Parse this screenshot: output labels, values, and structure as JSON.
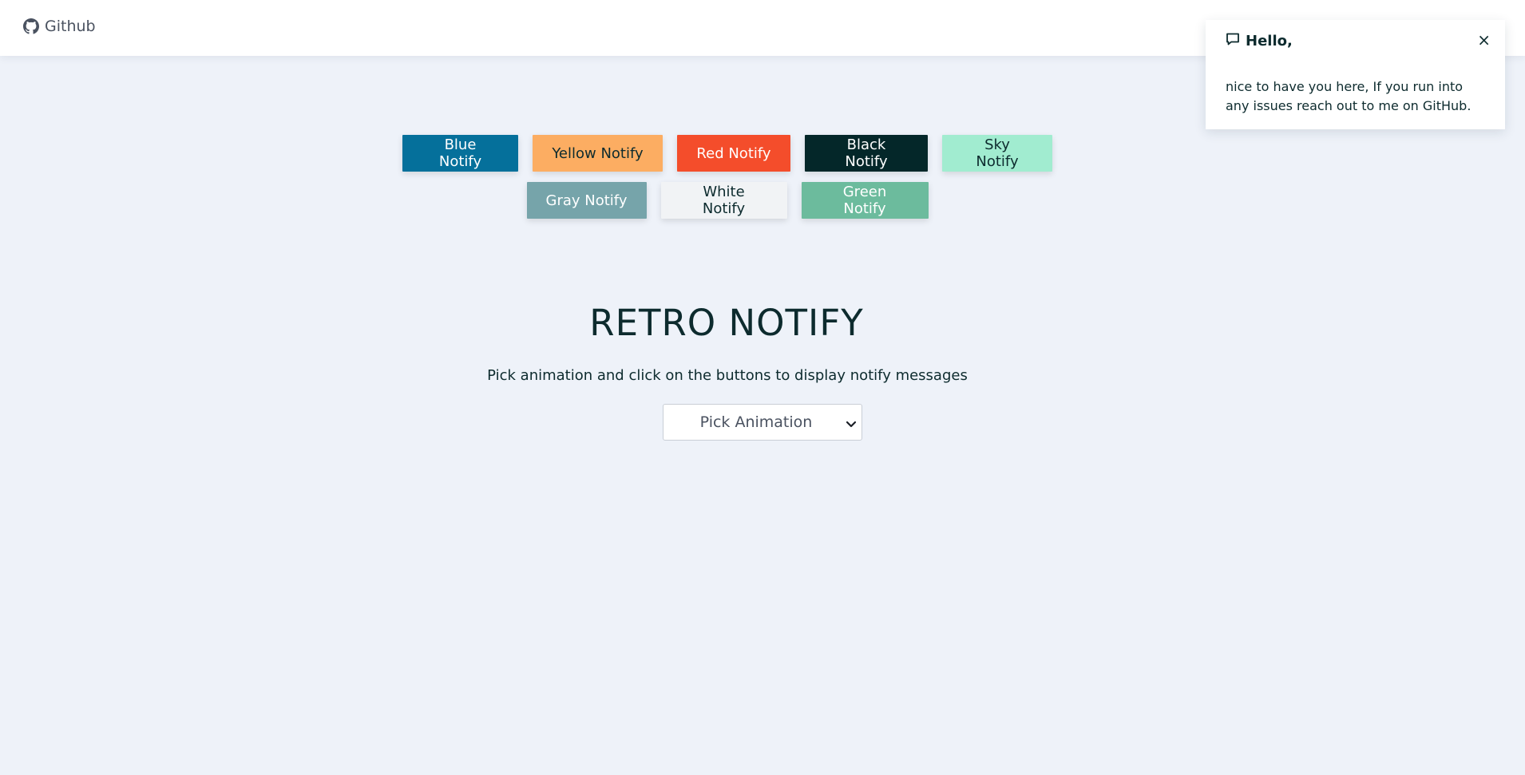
{
  "navbar": {
    "github_label": "Github",
    "github_icon": "github-icon"
  },
  "buttons": {
    "blue": "Blue Notify",
    "yellow": "Yellow Notify",
    "red": "Red Notify",
    "black": "Black Notify",
    "sky": "Sky Notify",
    "gray": "Gray Notify",
    "white": "White Notify",
    "green": "Green Notify"
  },
  "main": {
    "title": "RETRO NOTIFY",
    "subtitle": "Pick animation and click on the buttons to display notify messages",
    "select_value": "Pick Animation"
  },
  "toast": {
    "icon": "message-icon",
    "title": "Hello,",
    "close": "×",
    "message": "nice to have you here, If you run into any issues reach out to me on GitHub."
  },
  "colors": {
    "background": "#eef2f9",
    "blue": "#05709b",
    "yellow": "#fcad62",
    "red": "#f44d2b",
    "black": "#042729",
    "sky": "#a1ecd0",
    "gray": "#76a4aa",
    "white": "#f1f3f5",
    "green": "#6cbb9d",
    "text": "#0d2b2e"
  }
}
